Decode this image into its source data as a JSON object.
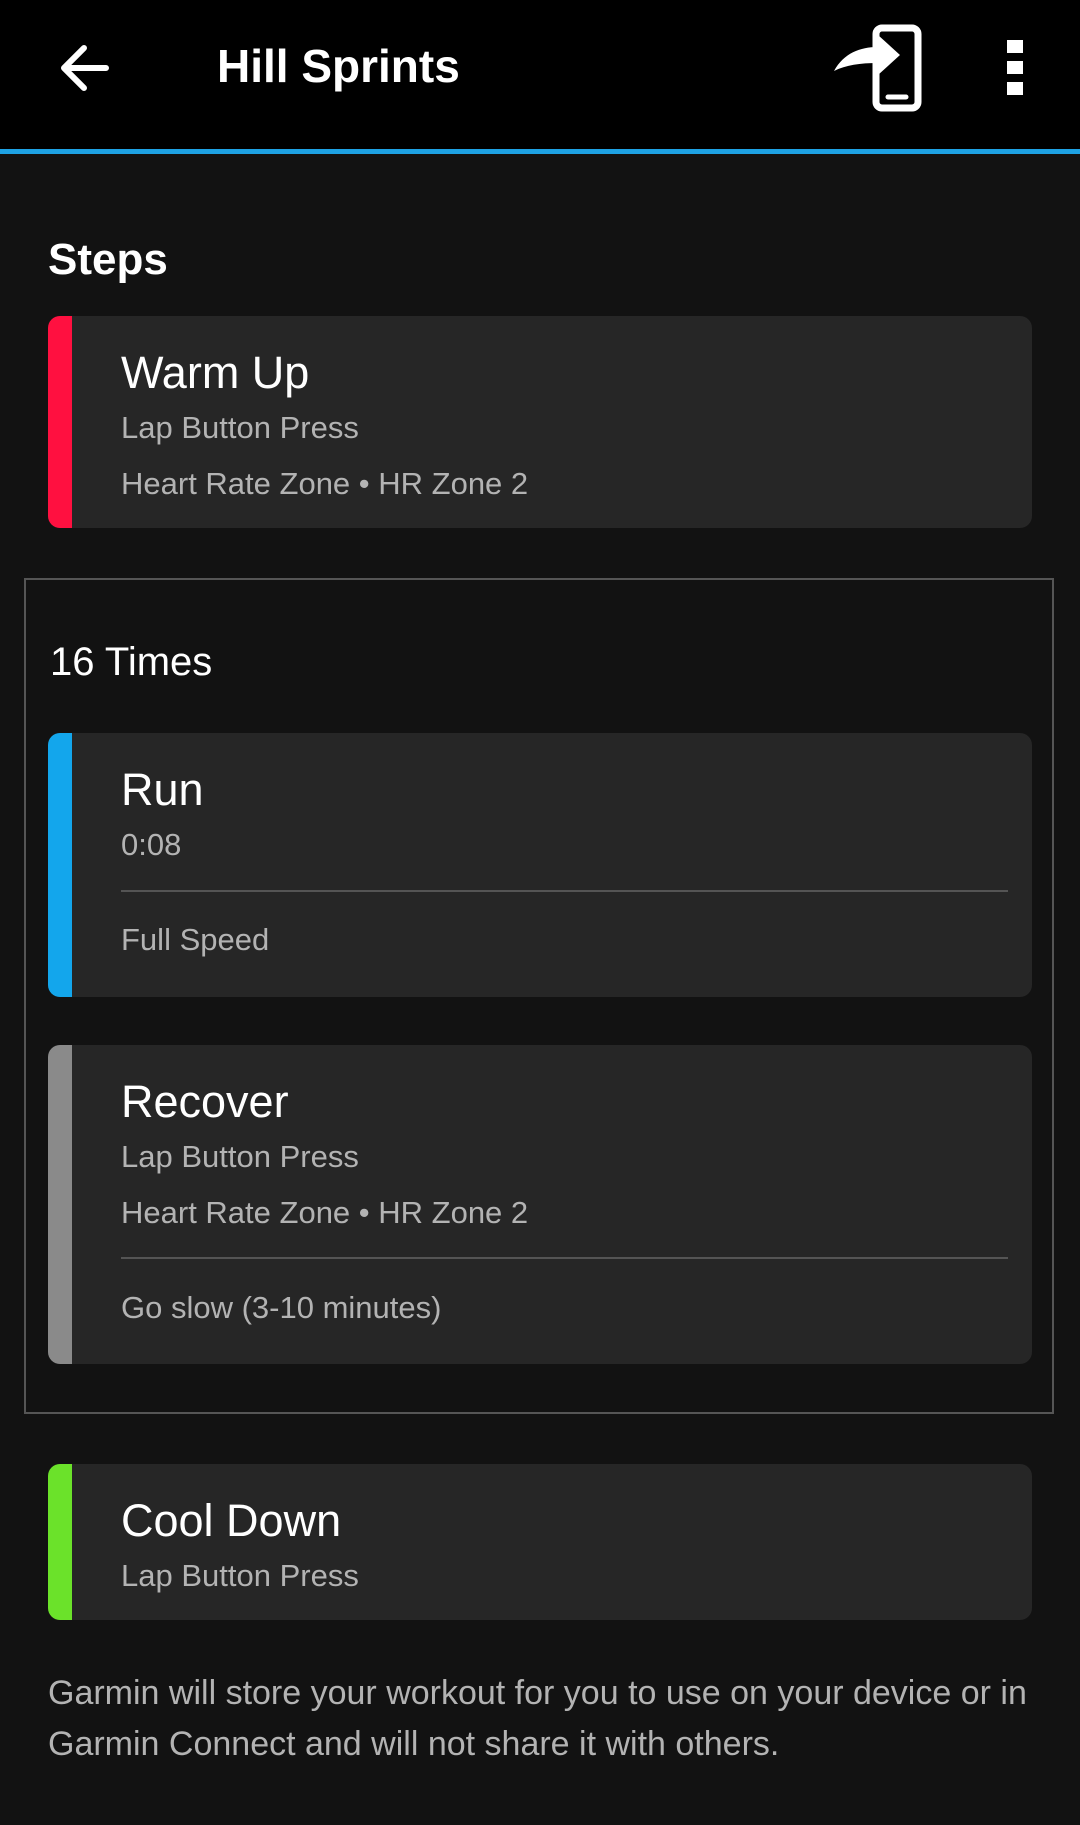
{
  "header": {
    "title": "Hill Sprints",
    "back_icon": "arrow-back-icon",
    "send_icon": "send-to-device-icon",
    "more_icon": "more-vertical-icon",
    "accent_color": "#1ea2e4"
  },
  "steps": {
    "section_title": "Steps",
    "warm_up": {
      "name": "Warm Up",
      "duration": "Lap Button Press",
      "target": "Heart Rate Zone • HR Zone 2",
      "color": "#ff1040"
    },
    "repeat": {
      "label": "16 Times",
      "run": {
        "name": "Run",
        "duration": "0:08",
        "note": "Full Speed",
        "color": "#13a6ec"
      },
      "recover": {
        "name": "Recover",
        "duration": "Lap Button Press",
        "target": "Heart Rate Zone • HR Zone 2",
        "note": "Go slow (3-10 minutes)",
        "color": "#8a8a8a"
      }
    },
    "cool_down": {
      "name": "Cool Down",
      "duration": "Lap Button Press",
      "color": "#6be22a"
    }
  },
  "footer": {
    "note": "Garmin will store your workout for you to use on your device or in Garmin Connect and will not share it with others."
  }
}
